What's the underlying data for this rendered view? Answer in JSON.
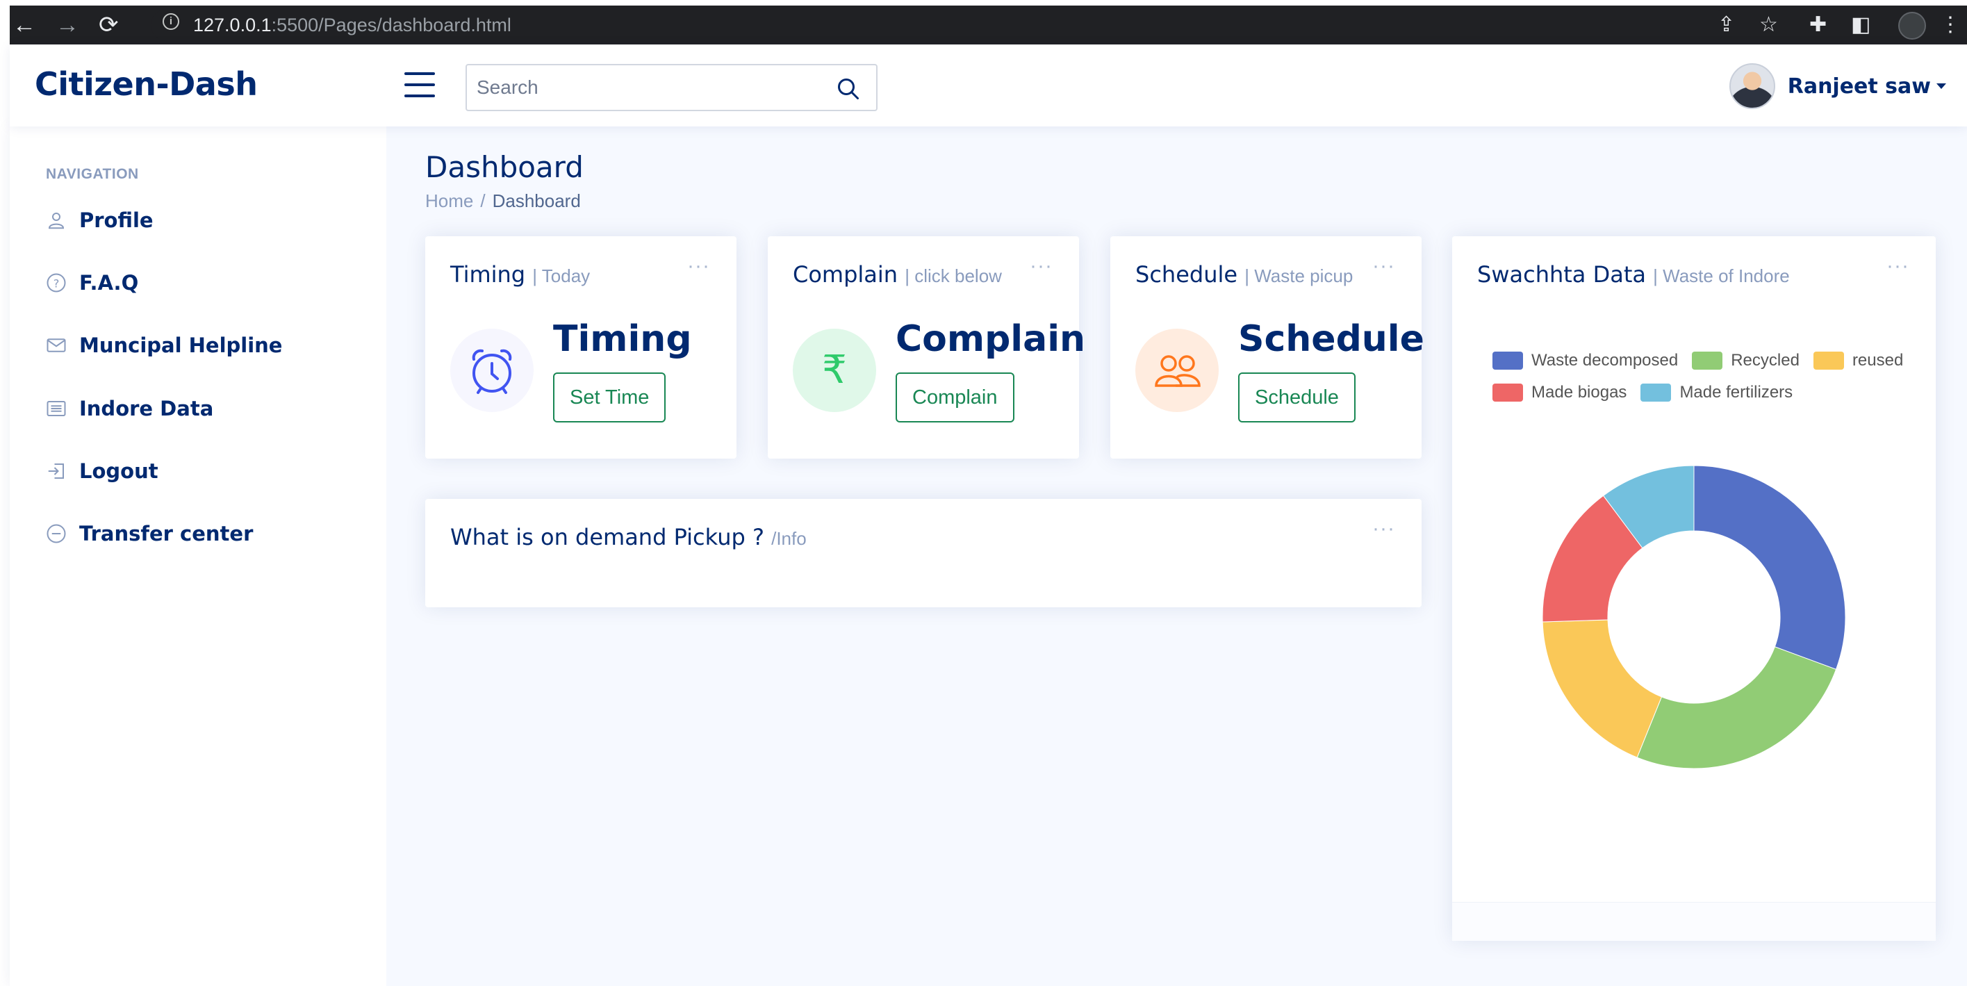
{
  "browser": {
    "url_host": "127.0.0.1",
    "url_rest": ":5500/Pages/dashboard.html"
  },
  "header": {
    "logo": "Citizen-Dash",
    "search_placeholder": "Search",
    "user_name": "Ranjeet saw"
  },
  "sidebar": {
    "heading": "NAVIGATION",
    "items": [
      {
        "label": "Profile",
        "icon": "person-icon"
      },
      {
        "label": "F.A.Q",
        "icon": "question-circle-icon"
      },
      {
        "label": "Muncipal Helpline",
        "icon": "envelope-icon"
      },
      {
        "label": "Indore Data",
        "icon": "card-list-icon"
      },
      {
        "label": "Logout",
        "icon": "box-arrow-in-right-icon"
      },
      {
        "label": "Transfer center",
        "icon": "dash-circle-icon"
      }
    ]
  },
  "page": {
    "title": "Dashboard",
    "breadcrumb": [
      "Home",
      "Dashboard"
    ]
  },
  "cards": {
    "timing": {
      "title": "Timing",
      "subtitle": "| Today",
      "value": "Timing",
      "button": "Set Time",
      "icon": "alarm-icon",
      "icon_color": "#4154f1",
      "icon_bg": "#f6f6fe"
    },
    "complain": {
      "title": "Complain",
      "subtitle": "| click below",
      "value": "Complain",
      "button": "Complain",
      "icon": "rupee-icon",
      "icon_color": "#2eca6a",
      "icon_bg": "#e0f8e9"
    },
    "schedule": {
      "title": "Schedule",
      "subtitle": "| Waste picup",
      "value": "Schedule",
      "button": "Schedule",
      "icon": "people-icon",
      "icon_color": "#ff771d",
      "icon_bg": "#ffecdf"
    },
    "pickup": {
      "title": "What is on demand Pickup ?",
      "subtitle": "/Info"
    },
    "swachhta": {
      "title": "Swachhta Data",
      "subtitle": "| Waste of Indore"
    }
  },
  "chart_data": {
    "type": "pie",
    "title": "Swachhta Data",
    "labels": [
      "Waste decomposed",
      "Recycled",
      "reused",
      "Made biogas",
      "Made fertilizers"
    ],
    "values": [
      30,
      25,
      18,
      15,
      10
    ],
    "colors": [
      "#5470c6",
      "#91cc75",
      "#fac858",
      "#ee6666",
      "#73c0de"
    ],
    "legend": "top",
    "donut": true
  }
}
